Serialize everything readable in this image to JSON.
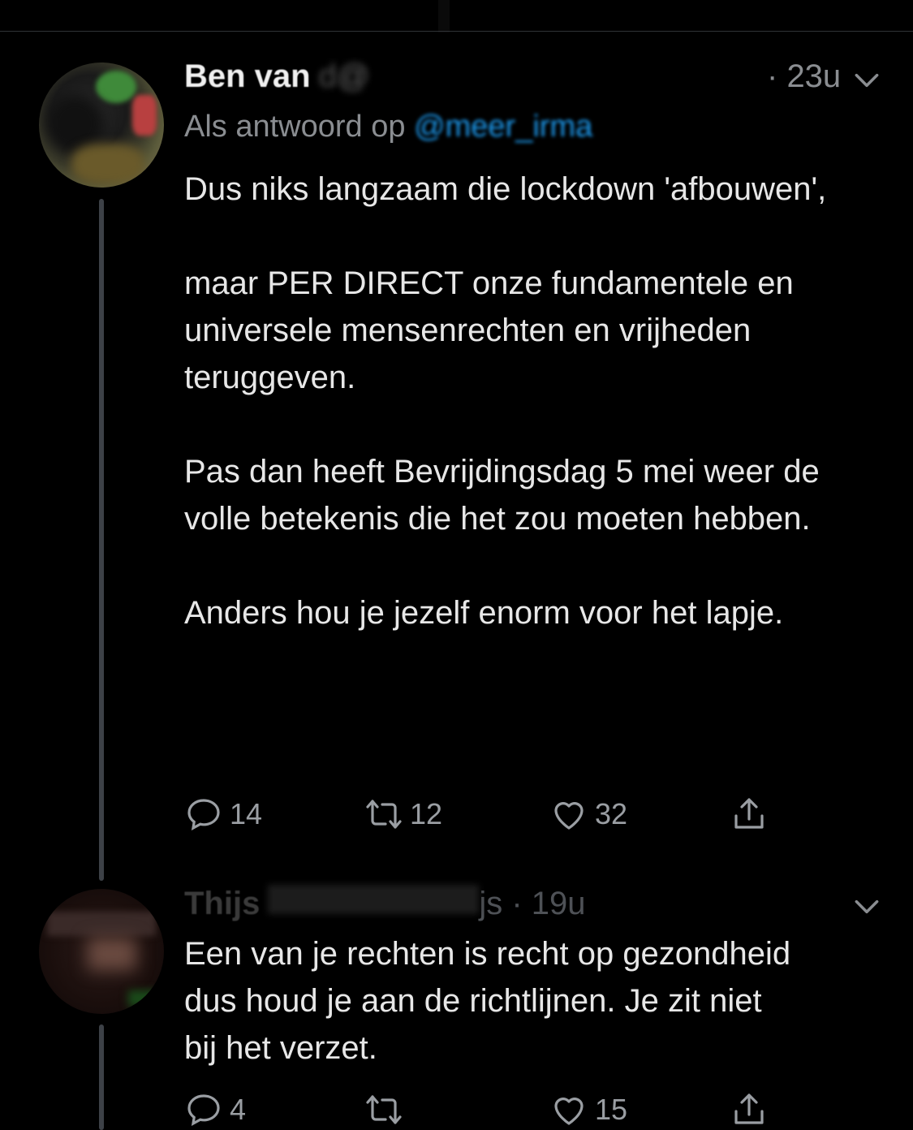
{
  "tweets": [
    {
      "name": "Ben van",
      "name_rest": "d",
      "handle": "@",
      "time": "23u",
      "reply_prefix": "Als antwoord op",
      "reply_mention": "@meer_irma",
      "paragraphs": [
        "Dus niks langzaam die lockdown 'afbouwen',",
        "maar PER DIRECT onze fundamentele en universele mensenrechten en vrijheden teruggeven.",
        "Pas dan heeft Bevrijdingsdag 5 mei weer de volle betekenis die het zou moeten hebben.",
        "Anders hou je jezelf enorm voor het lapje."
      ],
      "replies": "14",
      "retweets": "12",
      "likes": "32"
    },
    {
      "name": "Thijs",
      "name_rest": "",
      "handle": "",
      "time": "19u",
      "paragraphs": [
        "Een van je rechten is recht op gezondheid dus houd je aan de richtlijnen. Je zit niet bij het verzet."
      ],
      "replies": "4",
      "retweets": "",
      "likes": "15"
    }
  ],
  "icons": {
    "reply": "reply-icon",
    "retweet": "retweet-icon",
    "like": "heart-icon",
    "share": "share-icon",
    "more": "chevron-down-icon"
  },
  "colors": {
    "background": "#000000",
    "text": "#e7e7e7",
    "secondary": "#8a8d91",
    "link": "#1d9bf0"
  }
}
